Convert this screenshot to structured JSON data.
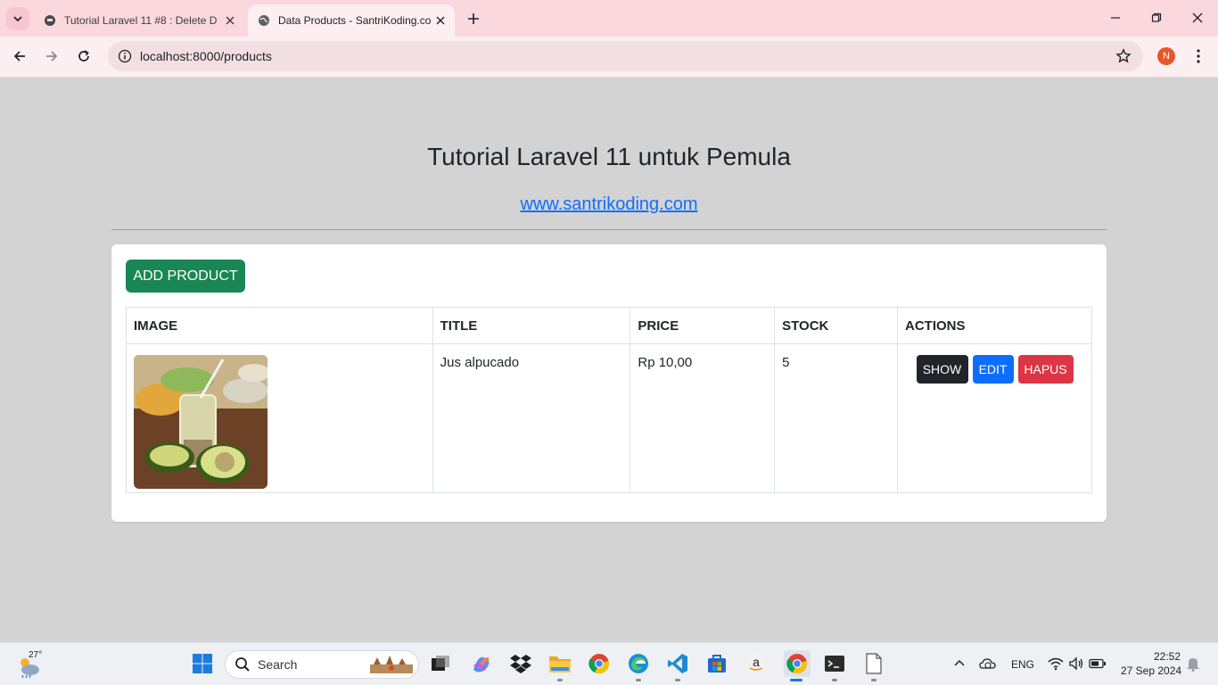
{
  "browser": {
    "tabs": [
      {
        "title": "Tutorial Laravel 11 #8 : Delete D",
        "active": false
      },
      {
        "title": "Data Products - SantriKoding.co",
        "active": true
      }
    ],
    "url": "localhost:8000/products",
    "profile_initial": "N"
  },
  "page": {
    "heading": "Tutorial Laravel 11 untuk Pemula",
    "link_text": "www.santrikoding.com",
    "add_button": "ADD PRODUCT",
    "table": {
      "headers": [
        "IMAGE",
        "TITLE",
        "PRICE",
        "STOCK",
        "ACTIONS"
      ],
      "rows": [
        {
          "title": "Jus alpucado",
          "price": "Rp 10,00",
          "stock": "5",
          "actions": {
            "show": "SHOW",
            "edit": "EDIT",
            "delete": "HAPUS"
          }
        }
      ]
    }
  },
  "colors": {
    "add_button": "#198754",
    "show_button": "#212529",
    "edit_button": "#0d6efd",
    "delete_button": "#dc3545",
    "page_background": "#d3d3d3"
  },
  "taskbar": {
    "weather_temp": "27°",
    "search_label": "Search",
    "language": "ENG",
    "time": "22:52",
    "date": "27 Sep 2024"
  }
}
